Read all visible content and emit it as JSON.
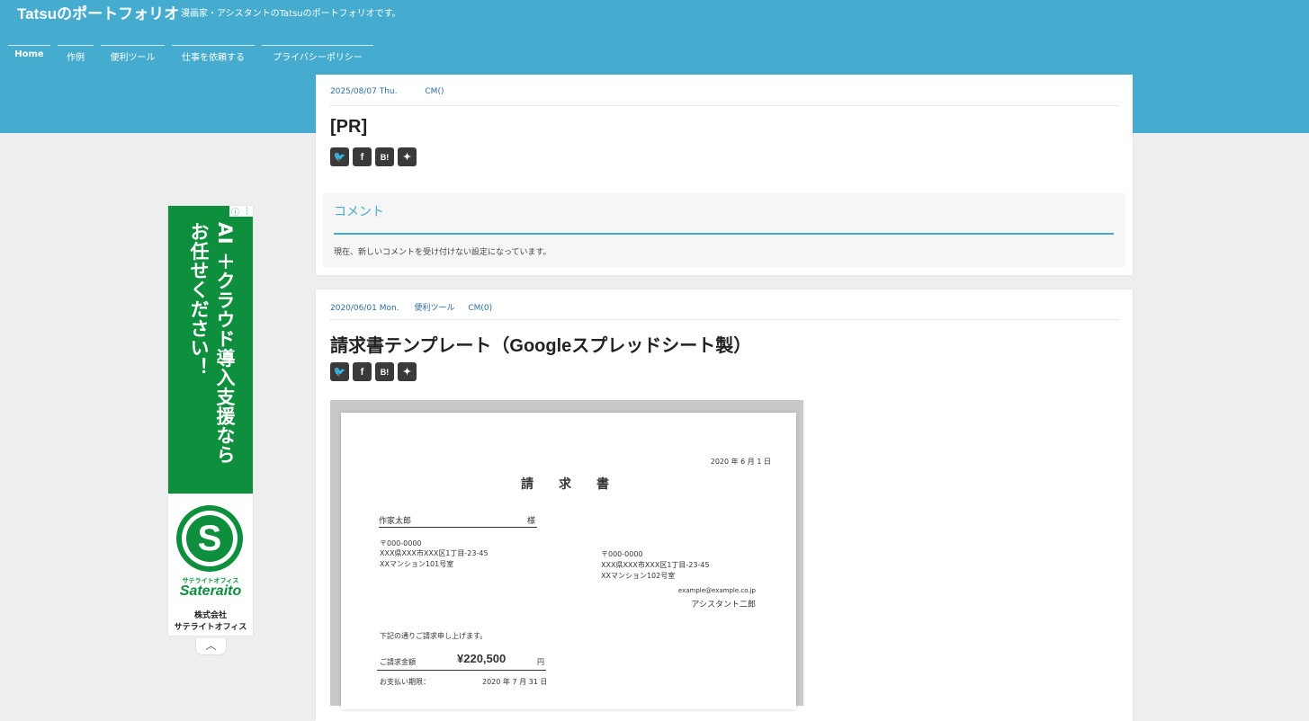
{
  "site": {
    "title": "Tatsuのポートフォリオ",
    "description": "漫画家・アシスタントのTatsuのポートフォリオです。"
  },
  "nav": [
    "Home",
    "作例",
    "便利ツール",
    "仕事を依頼する",
    "プライバシーポリシー"
  ],
  "post1": {
    "date": "2025/08/07 Thu.",
    "category": "",
    "comments": "CM()",
    "title": "[PR]"
  },
  "share_icons": [
    "twitter-icon",
    "facebook-icon",
    "hatena-icon",
    "feedly-icon"
  ],
  "share_glyphs": [
    "🐦",
    "f",
    "B!",
    "✦"
  ],
  "comment_section": {
    "heading": "コメント",
    "text": "現在、新しいコメントを受け付けない設定になっています。"
  },
  "post2": {
    "date": "2020/06/01 Mon.",
    "category": "便利ツール",
    "comments": "CM(0)",
    "title": "請求書テンプレート（Googleスプレッドシート製）"
  },
  "invoice": {
    "date": "2020 年 6 月 1 日",
    "heading": "請　　求　　書",
    "recipient": "作家太郎",
    "honorific": "様",
    "recipient_zip": "〒000-0000",
    "recipient_addr1": "XXX県XXX市XXX区1丁目-23-45",
    "recipient_addr2": "XXマンション101号室",
    "sender_zip": "〒000-0000",
    "sender_addr1": "XXX県XXX市XXX区1丁目-23-45",
    "sender_addr2": "XXマンション102号室",
    "sender_email": "example@example.co.jp",
    "sender_name": "アシスタント二郎",
    "lead": "下記の通りご請求申し上げます。",
    "amount_label": "ご請求金額",
    "amount": "¥220,500",
    "amount_unit": "円",
    "due_label": "お支払い期限：",
    "due_date": "2020 年 7 月 31 日"
  },
  "ad": {
    "col_right": "AI ＋クラウド導入支援なら",
    "col_left": "お任せください！",
    "logo_letter": "S",
    "kana": "サテライトオフィス",
    "brand": "Sateraito",
    "company_line1": "株式会社",
    "company_line2": "サテライトオフィス",
    "info_glyph": "ⓘ",
    "menu_glyph": "⋮",
    "collapse_glyph": "︿"
  }
}
